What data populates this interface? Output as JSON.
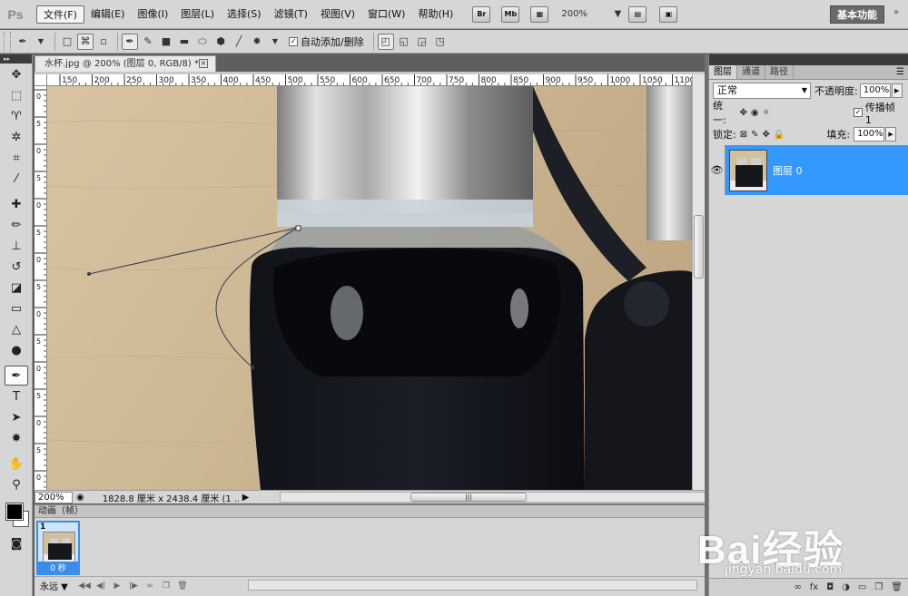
{
  "app": {
    "logo": "Ps",
    "workspace": "基本功能"
  },
  "menu": [
    "文件(F)",
    "编辑(E)",
    "图像(I)",
    "图层(L)",
    "选择(S)",
    "滤镜(T)",
    "视图(V)",
    "窗口(W)",
    "帮助(H)"
  ],
  "menubar_icons": {
    "bridge": "Br",
    "mini_bridge": "Mb",
    "zoom": "200%"
  },
  "options_bar": {
    "auto_add_delete": "自动添加/删除",
    "auto_add_checked": true
  },
  "document": {
    "tab_title": "水杯.jpg @ 200% (图层 0, RGB/8) *",
    "zoom": "200%",
    "info": "1828.8 厘米 x 2438.4 厘米 (1 ...",
    "ruler_h": [
      "150",
      "200",
      "250",
      "300",
      "350",
      "400",
      "450",
      "500",
      "550",
      "600",
      "650",
      "700",
      "750",
      "800",
      "850",
      "900",
      "950",
      "1000",
      "1050",
      "1100"
    ],
    "ruler_v": [
      "0",
      "5",
      "0",
      "5",
      "0",
      "5",
      "0",
      "5",
      "0",
      "5",
      "0",
      "5",
      "0",
      "5",
      "0"
    ]
  },
  "animation": {
    "title": "动画（帧）",
    "frame_number": "1",
    "frame_time": "0 秒",
    "loop": "永远"
  },
  "layers_panel": {
    "tabs": [
      "图层",
      "通道",
      "路径"
    ],
    "blend_mode": "正常",
    "opacity_label": "不透明度:",
    "opacity": "100%",
    "unify_label": "统一:",
    "propagate_label": "传播帧 1",
    "lock_label": "锁定:",
    "fill_label": "填充:",
    "fill": "100%",
    "layers": [
      {
        "name": "图层 0",
        "visible": true,
        "selected": true
      }
    ]
  },
  "watermark": {
    "logo": "Bai经验",
    "url": "jingyan.baidu.com"
  },
  "colors": {
    "selection_blue": "#3399ff",
    "ui_gray": "#d6d6d6"
  }
}
